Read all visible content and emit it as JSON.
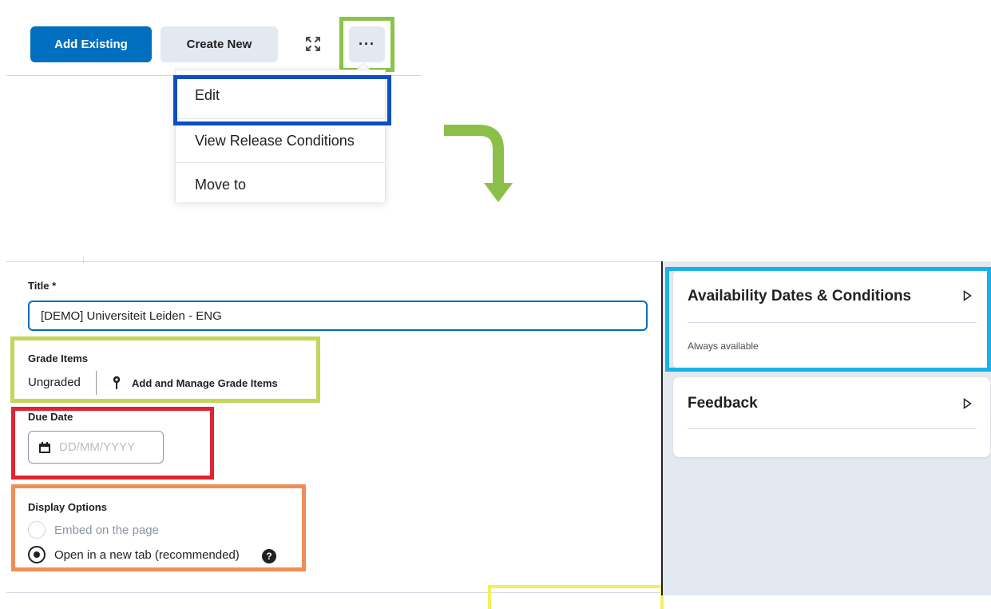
{
  "toolbar": {
    "add_existing_label": "Add Existing",
    "create_new_label": "Create New",
    "fullscreen_icon": "fullscreen-icon",
    "more_label": "···"
  },
  "menu": {
    "items": [
      {
        "label": "Edit"
      },
      {
        "label": "View Release Conditions"
      },
      {
        "label": "Move to"
      }
    ]
  },
  "form": {
    "title_label": "Title *",
    "title_value": "[DEMO] Universiteit Leiden - ENG",
    "grade_items_label": "Grade Items",
    "grade_status": "Ungraded",
    "grade_link": "Add and Manage Grade Items",
    "due_date_label": "Due Date",
    "due_date_placeholder": "DD/MM/YYYY",
    "display_options_label": "Display Options",
    "options": [
      {
        "label": "Embed on the page",
        "selected": false,
        "disabled": true
      },
      {
        "label": "Open in a new tab (recommended)",
        "selected": true,
        "disabled": false
      }
    ]
  },
  "right_panel": {
    "availability_title": "Availability Dates & Conditions",
    "availability_status": "Always available",
    "feedback_title": "Feedback"
  },
  "colors": {
    "primary": "#006fbf",
    "highlight_green": "#8cc24a",
    "highlight_blue": "#0b4fc4",
    "highlight_lime": "#c2d65a",
    "highlight_red": "#e02433",
    "highlight_orange": "#f08d56",
    "highlight_cyan": "#1bb0e6",
    "highlight_yellow": "#f5ef5a",
    "arrow": "#8cbf4a"
  }
}
